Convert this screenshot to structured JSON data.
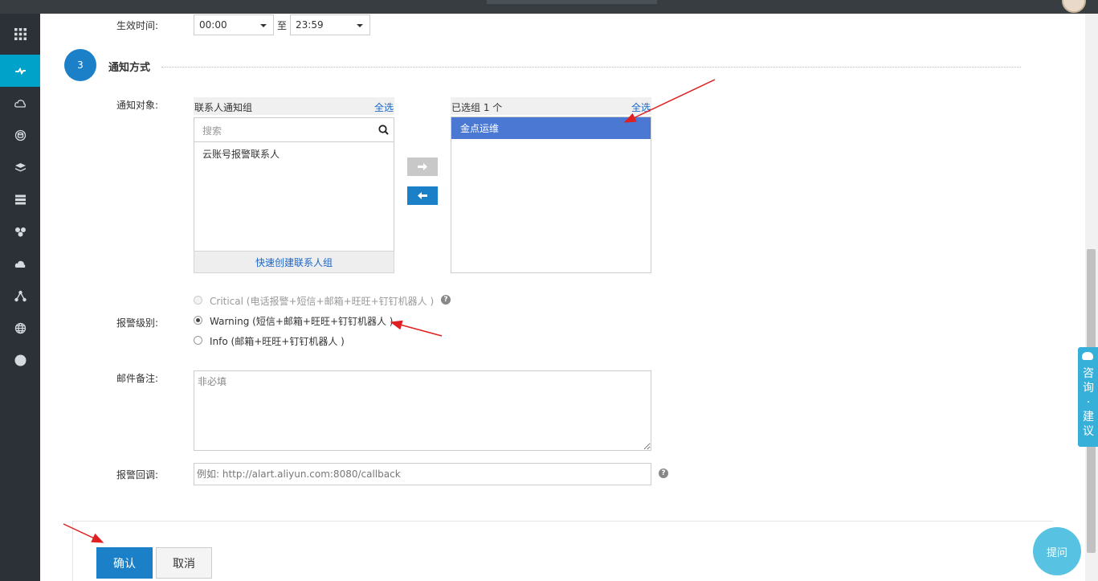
{
  "effective_time": {
    "label": "生效时间:",
    "start": "00:00",
    "separator": "至",
    "end": "23:59"
  },
  "section": {
    "step": "3",
    "title": "通知方式"
  },
  "notify_target": {
    "label": "通知对象:",
    "left_panel": {
      "title": "联系人通知组",
      "select_all": "全选",
      "search_placeholder": "搜索",
      "items": [
        "云账号报警联系人"
      ],
      "quick_create": "快速创建联系人组"
    },
    "right_panel": {
      "title": "已选组 1 个",
      "select_all": "全选",
      "items": [
        "金点运维"
      ]
    }
  },
  "alert_level": {
    "label": "报警级别:",
    "options": [
      {
        "text": "Critical (电话报警+短信+邮箱+旺旺+钉钉机器人 )",
        "checked": false,
        "disabled": true
      },
      {
        "text": "Warning (短信+邮箱+旺旺+钉钉机器人 )",
        "checked": true,
        "disabled": false
      },
      {
        "text": "Info (邮箱+旺旺+钉钉机器人 )",
        "checked": false,
        "disabled": false
      }
    ]
  },
  "mail_note": {
    "label": "邮件备注:",
    "placeholder": "非必填"
  },
  "callback": {
    "label": "报警回调:",
    "placeholder": "例如: http://alart.aliyun.com:8080/callback"
  },
  "buttons": {
    "confirm": "确认",
    "cancel": "取消"
  },
  "side_tab": {
    "text": "咨询·建议"
  },
  "ask_button": "提问",
  "colors": {
    "primary": "#1c80c8",
    "sidebar_active": "#00a2ca",
    "selected_item": "#4a78d2",
    "link": "#1c66c8",
    "annotation_arrow": "#e02020"
  }
}
